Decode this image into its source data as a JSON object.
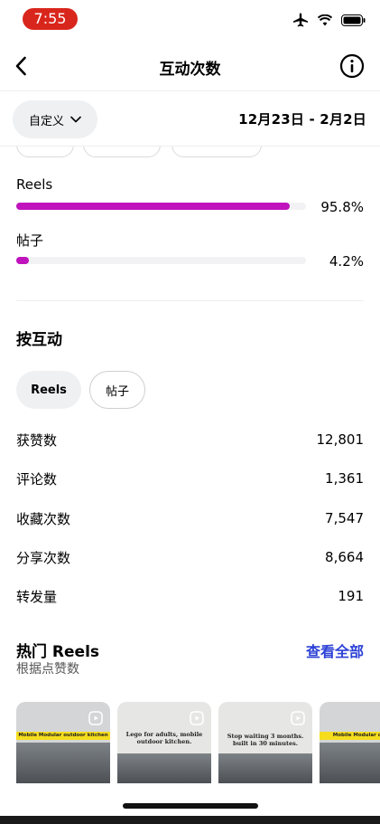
{
  "status_bar": {
    "time": "7:55",
    "icons": [
      "airplane-icon",
      "wifi-icon",
      "battery-icon"
    ]
  },
  "nav": {
    "title": "互动次数",
    "back_icon": "chevron-left-icon",
    "info_icon": "info-icon"
  },
  "filter": {
    "period_label": "自定义",
    "period_icon": "chevron-down-icon",
    "date_range": "12月23日 - 2月2日"
  },
  "distribution": [
    {
      "label": "Reels",
      "percent_text": "95.8%",
      "fraction": 0.958,
      "color": "#c013bd"
    },
    {
      "label": "帖子",
      "percent_text": "4.2%",
      "fraction": 0.042,
      "color": "#c013bd"
    }
  ],
  "by_interaction": {
    "title": "按互动",
    "tabs": [
      {
        "label": "Reels",
        "selected": true
      },
      {
        "label": "帖子",
        "selected": false
      }
    ],
    "metrics": [
      {
        "label": "获赞数",
        "value": "12,801"
      },
      {
        "label": "评论数",
        "value": "1,361"
      },
      {
        "label": "收藏次数",
        "value": "7,547"
      },
      {
        "label": "分享次数",
        "value": "8,664"
      },
      {
        "label": "转发量",
        "value": "191"
      }
    ]
  },
  "top_reels": {
    "title": "热门 Reels",
    "subtitle": "根据点赞数",
    "see_all": "查看全部",
    "thumbnails": [
      {
        "caption": "",
        "banner": "Mobile Modular outdoor kitchen"
      },
      {
        "caption": "Lego for adults, mobile outdoor kitchen.",
        "banner": ""
      },
      {
        "caption": "Stop waiting 3 months. built in 30 minutes.",
        "banner": ""
      },
      {
        "caption": "",
        "banner": "Mobile Modular outdoor"
      }
    ]
  },
  "colors": {
    "accent_bar": "#c013bd",
    "link_blue": "#2c41d6",
    "time_pill": "#d9261c"
  }
}
